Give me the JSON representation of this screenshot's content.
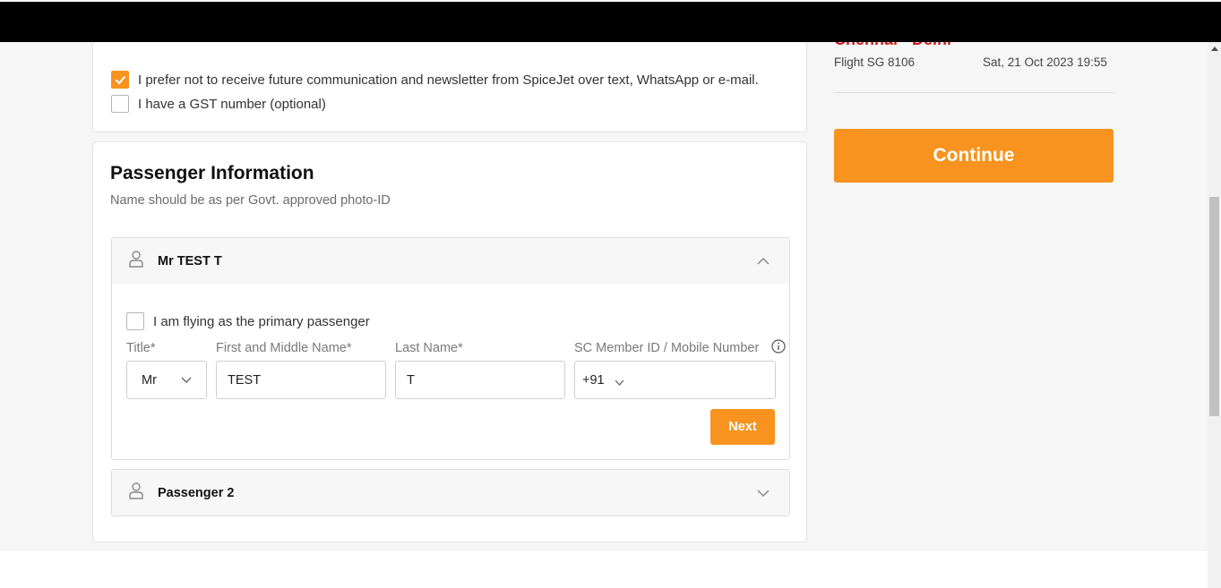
{
  "header": {},
  "preferences": {
    "no_newsletter_label": "I prefer not to receive future communication and newsletter from SpiceJet over text, WhatsApp or e-mail.",
    "no_newsletter_checked": true,
    "gst_label": "I have a GST number (optional)",
    "gst_checked": false
  },
  "passenger_info": {
    "title": "Passenger Information",
    "subtitle": "Name should be as per Govt. approved photo-ID",
    "passengers": [
      {
        "name": "Mr TEST T",
        "expanded": true,
        "primary_label": "I am flying as the primary passenger",
        "primary_checked": false,
        "labels": {
          "title": "Title*",
          "first_middle": "First and Middle Name*",
          "last": "Last Name*",
          "member_id": "SC Member ID / Mobile Number"
        },
        "values": {
          "title": "Mr",
          "first_middle": "TEST",
          "last": "T",
          "country_code": "+91",
          "member_id": ""
        },
        "next_label": "Next"
      },
      {
        "name": "Passenger 2",
        "expanded": false
      }
    ]
  },
  "summary": {
    "route": "Chennai - Delhi",
    "flight": "Flight  SG 8106",
    "date": "Sat, 21 Oct 2023 19:55",
    "continue_label": "Continue"
  },
  "colors": {
    "accent": "#f7931e",
    "route_red": "#cc1d1d",
    "top_bar": "#000000"
  },
  "icons": [
    "check-icon",
    "person-icon",
    "chevron-up-icon",
    "chevron-down-icon",
    "info-icon"
  ]
}
